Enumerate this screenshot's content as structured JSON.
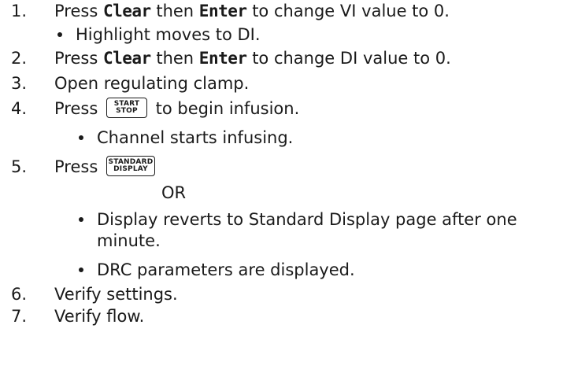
{
  "steps": [
    {
      "number": "1.",
      "before": "Press ",
      "key1": "Clear",
      "mid": " then ",
      "key2": "Enter",
      "after": " to change VI value to 0.",
      "sub": [
        "Highlight moves to DI."
      ]
    },
    {
      "number": "2.",
      "before": "Press ",
      "key1": "Clear",
      "mid": " then ",
      "key2": "Enter",
      "after": " to change DI value to 0."
    },
    {
      "number": "3.",
      "text": "Open regulating clamp."
    },
    {
      "number": "4.",
      "before": "Press",
      "button_line1": "START",
      "button_line2": "STOP",
      "after": "to begin infusion.",
      "sub": [
        "Channel starts infusing."
      ]
    },
    {
      "number": "5.",
      "before": "Press",
      "button_line1": "STANDARD",
      "button_line2": "DISPLAY",
      "or_label": "OR",
      "sub": [
        "Display reverts to Standard Display page after one",
        "minute.",
        "DRC parameters are displayed."
      ]
    },
    {
      "number": "6.",
      "text": "Verify settings."
    },
    {
      "number": "7.",
      "text": "Verify flow."
    }
  ]
}
